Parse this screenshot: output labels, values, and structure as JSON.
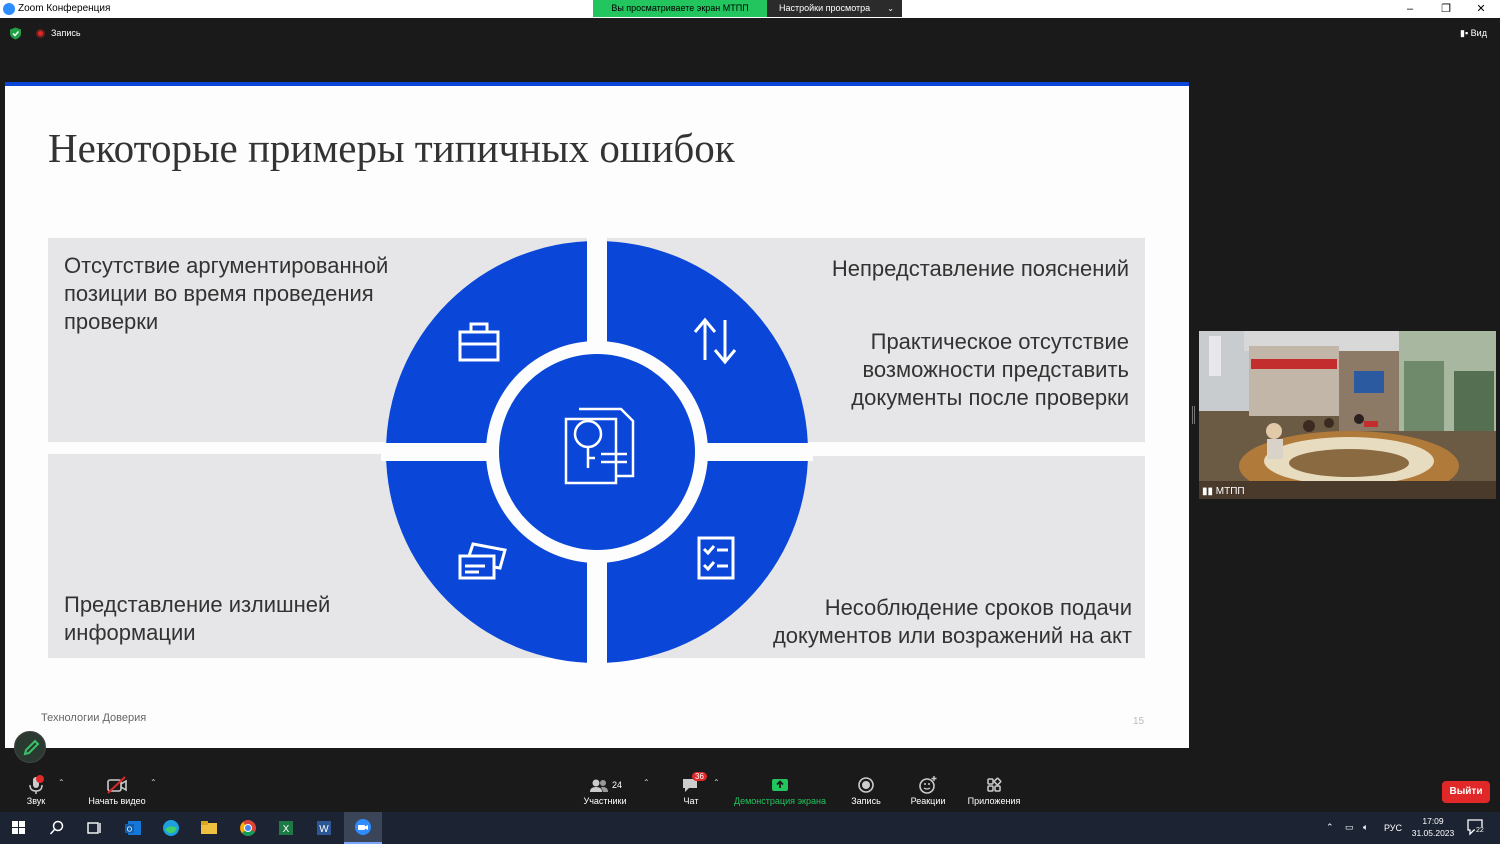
{
  "window": {
    "title": "Zoom Конференция",
    "minimize": "–",
    "restore": "❐",
    "close": "✕"
  },
  "share_banner": {
    "label": "Вы просматриваете экран МТПП",
    "view_settings": "Настройки просмотра"
  },
  "meeting_bar": {
    "recording_label": "Запись",
    "view_label": "Вид"
  },
  "slide": {
    "title": "Некоторые примеры типичных ошибок",
    "top_left": [
      "Отсутствие аргументированной",
      "позиции во время проведения",
      "проверки"
    ],
    "top_right_1": "Непредставление пояснений",
    "top_right_2": [
      "Практическое отсутствие",
      "возможности представить",
      "документы после проверки"
    ],
    "bottom_left": [
      "Представление излишней",
      "информации"
    ],
    "bottom_right": [
      "Несоблюдение сроков подачи",
      "документов или возражений на акт"
    ],
    "footer": "Технологии Доверия",
    "page": "15",
    "accent": "#0a46d8"
  },
  "video": {
    "participant_name": "МТПП"
  },
  "toolbar": {
    "audio": "Звук",
    "video": "Начать видео",
    "participants": "Участники",
    "participants_count": "24",
    "chat": "Чат",
    "chat_badge": "36",
    "share": "Демонстрация экрана",
    "record": "Запись",
    "reactions": "Реакции",
    "apps": "Приложения",
    "leave": "Выйти"
  },
  "taskbar": {
    "lang": "РУС",
    "time": "17:09",
    "date": "31.05.2023",
    "notif_count": "22"
  }
}
